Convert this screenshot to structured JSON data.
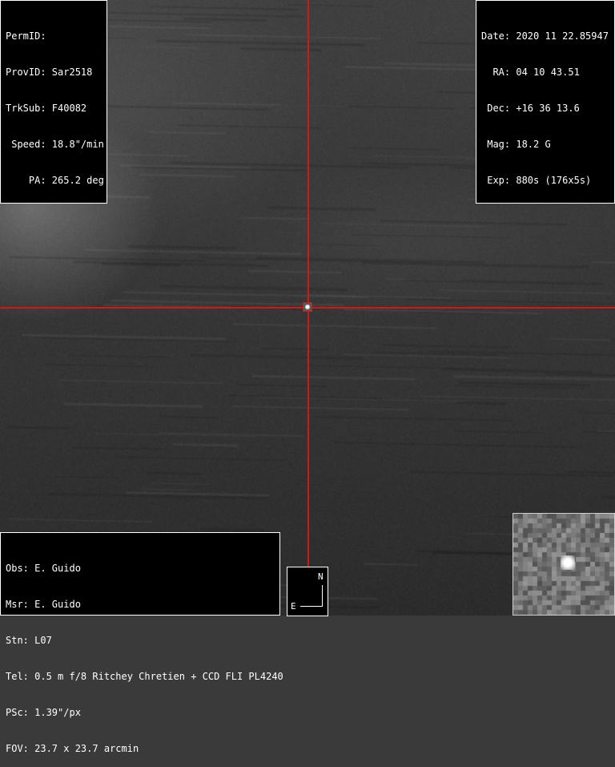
{
  "info_left": {
    "perm_id": "PermID:",
    "prov_id": "ProvID: Sar2518",
    "trk_sub": "TrkSub: F40082",
    "speed": " Speed: 18.8\"/min",
    "pa": "    PA: 265.2 deg"
  },
  "info_right": {
    "date": "Date: 2020 11 22.85947",
    "ra": "  RA: 04 10 43.51",
    "dec": " Dec: +16 36 13.6",
    "mag": " Mag: 18.2 G",
    "exp": " Exp: 880s (176x5s)"
  },
  "info_bottom": {
    "obs": "Obs: E. Guido",
    "msr": "Msr: E. Guido",
    "stn": "Stn: L07",
    "tel": "Tel: 0.5 m f/8 Ritchey Chretien + CCD FLI PL4240",
    "psc": "PSc: 1.39\"/px",
    "fov": "FOV: 23.7 x 23.7 arcmin"
  },
  "compass": {
    "north": "N",
    "east": "E"
  },
  "colors": {
    "crosshair": "#d01818",
    "panel_bg": "#000000",
    "panel_text": "#ffffff"
  }
}
